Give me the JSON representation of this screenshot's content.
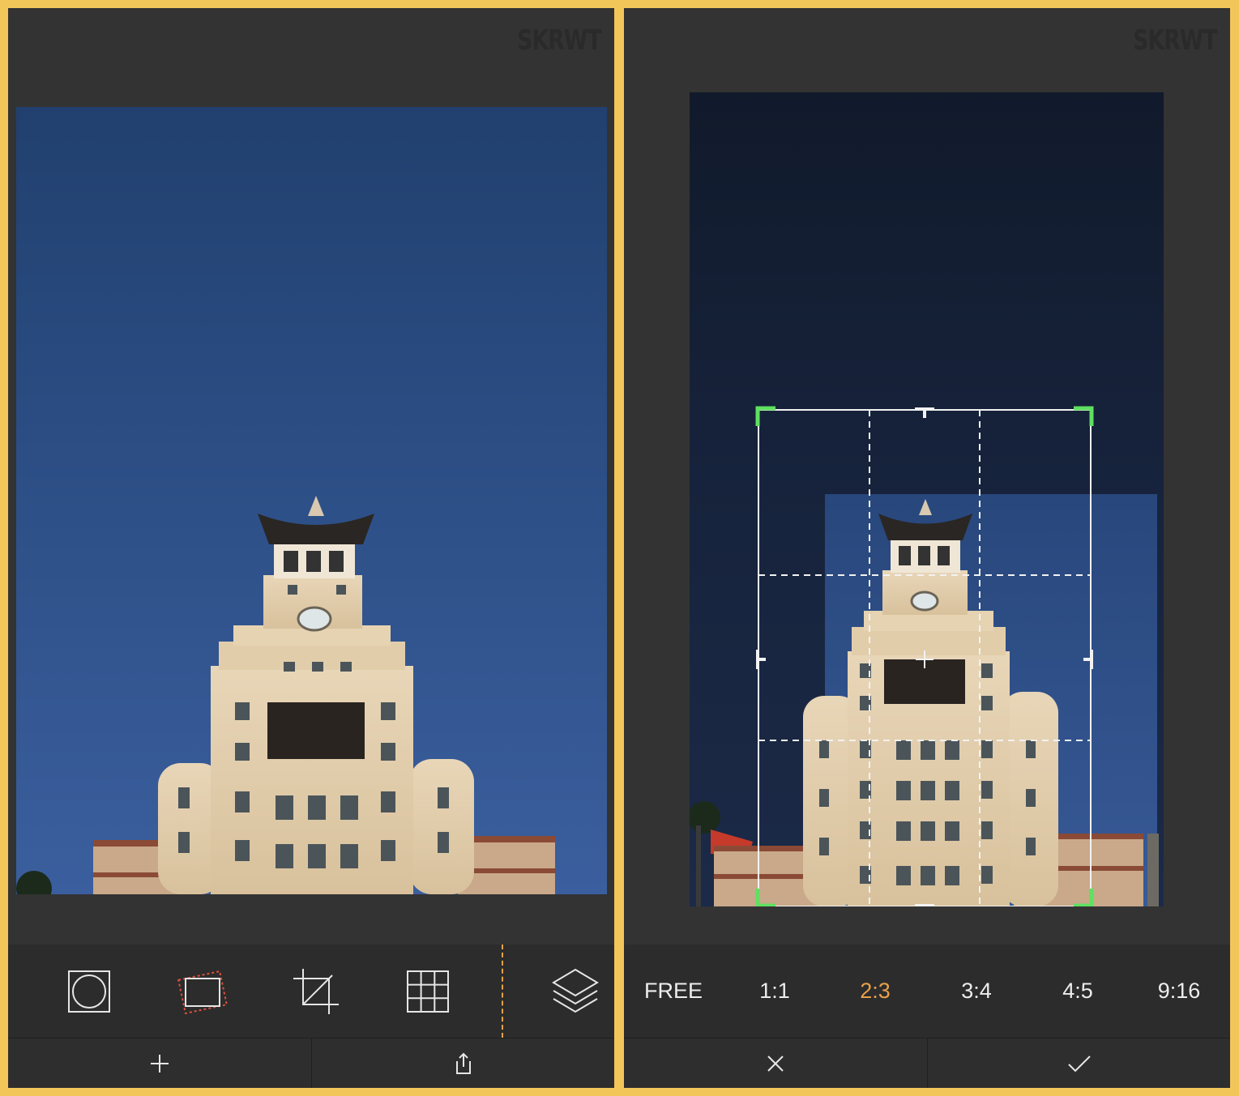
{
  "brand": "SKRWT",
  "left_screen": {
    "tools": [
      {
        "icon": "lens-circle-icon"
      },
      {
        "icon": "rotate-rectangle-icon"
      },
      {
        "icon": "crop-icon"
      },
      {
        "icon": "grid-icon"
      },
      {
        "icon": "layers-icon"
      }
    ],
    "bottom": {
      "left_icon": "plus-icon",
      "right_icon": "share-icon"
    }
  },
  "right_screen": {
    "ratios": [
      "FREE",
      "1:1",
      "2:3",
      "3:4",
      "4:5",
      "9:16"
    ],
    "active_ratio": "2:3",
    "bottom": {
      "left_icon": "close-icon",
      "right_icon": "checkmark-icon"
    }
  },
  "colors": {
    "frame": "#f3c65a",
    "accent_active": "#e8a04a",
    "crop_handle": "#5fe060",
    "panel": "#333333"
  }
}
